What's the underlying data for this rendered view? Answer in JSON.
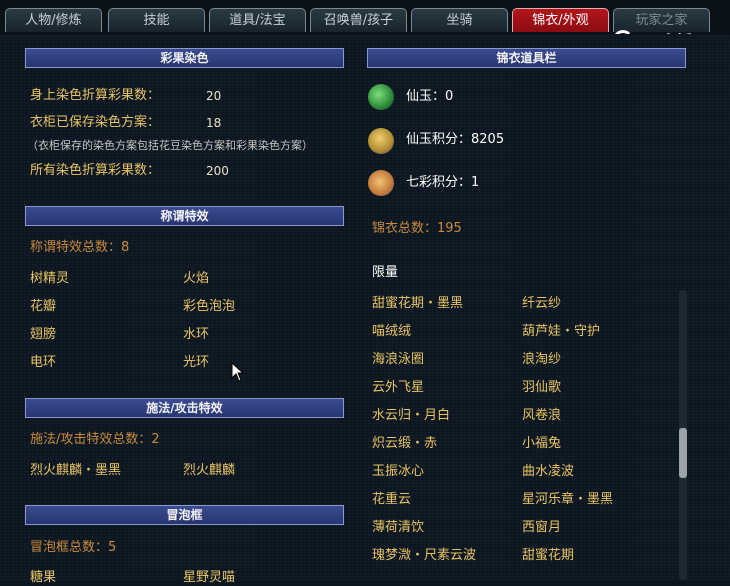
{
  "tabs": [
    {
      "label": "人物/修炼"
    },
    {
      "label": "技能"
    },
    {
      "label": "道具/法宝"
    },
    {
      "label": "召唤兽/孩子"
    },
    {
      "label": "坐骑"
    },
    {
      "label": "锦衣/外观"
    },
    {
      "label": "玩家之家"
    }
  ],
  "logo": {
    "text": "CC直播"
  },
  "caiguo": {
    "header": "彩果染色",
    "rows": [
      {
        "label": "身上染色折算彩果数：",
        "value": "20"
      },
      {
        "label": "衣柜已保存染色方案：",
        "value": "18"
      },
      {
        "label": "所有染色折算彩果数：",
        "value": "200"
      }
    ],
    "note": "（衣柜保存的染色方案包括花豆染色方案和彩果染色方案）"
  },
  "chenghao": {
    "header": "称谓特效",
    "total": "称谓特效总数：8",
    "items": [
      "树精灵",
      "火焰",
      "花瓣",
      "彩色泡泡",
      "翅膀",
      "水环",
      "电环",
      "光环"
    ]
  },
  "shifa": {
    "header": "施法/攻击特效",
    "total": "施法/攻击特效总数：2",
    "items": [
      "烈火麒麟・墨黑",
      "烈火麒麟"
    ]
  },
  "paopao": {
    "header": "冒泡框",
    "total": "冒泡框总数：5",
    "items": [
      "糖果",
      "星野灵喵"
    ]
  },
  "jinyi": {
    "header": "锦衣道具栏",
    "currencies": [
      {
        "icon": "xianyu-icon",
        "label": "仙玉：0"
      },
      {
        "icon": "xianyu-points-icon",
        "label": "仙玉积分：8205"
      },
      {
        "icon": "qicai-points-icon",
        "label": "七彩积分：1"
      }
    ],
    "total": "锦衣总数：195",
    "section": "限量",
    "items": [
      [
        "甜蜜花期・墨黑",
        "纤云纱"
      ],
      [
        "喵绒绒",
        "葫芦娃・守护"
      ],
      [
        "海浪泳圈",
        "浪淘纱"
      ],
      [
        "云外飞星",
        "羽仙歌"
      ],
      [
        "水云归・月白",
        "风卷浪"
      ],
      [
        "炽云缎・赤",
        "小福兔"
      ],
      [
        "玉振冰心",
        "曲水凌波"
      ],
      [
        "花重云",
        "星河乐章・墨黑"
      ],
      [
        "薄荷清饮",
        "西窗月"
      ],
      [
        "瑰梦溦・尺素云波",
        "甜蜜花期"
      ]
    ]
  }
}
